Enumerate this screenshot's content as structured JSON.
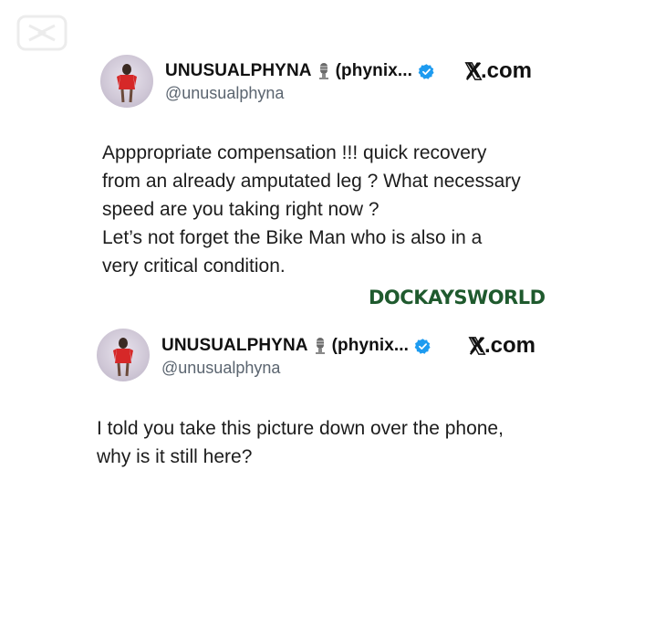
{
  "watermark_text": "DOCKAYSWORLD",
  "tweets": [
    {
      "display_name": "UNUSUALPHYNA",
      "name_suffix": "(phynix...",
      "handle": "@unusualphyna",
      "site": "X.com",
      "lines": [
        "Apppropriate compensation !!! quick recovery",
        "from an already amputated leg ? What necessary",
        "speed are you taking right now ?",
        "Let’s not forget the Bike Man who is also in a",
        "very critical condition."
      ]
    },
    {
      "display_name": "UNUSUALPHYNA",
      "name_suffix": "(phynix...",
      "handle": "@unusualphyna",
      "site": "X.com",
      "lines": [
        "I told you take this picture down over the phone,",
        "why is it still here?"
      ]
    }
  ],
  "colors": {
    "verified": "#1d9bf0",
    "watermark": "#1f5a2e",
    "handle": "#5b6570"
  },
  "icons": [
    "capcut-logo-icon",
    "microphone-icon",
    "verified-badge-icon",
    "x-logo-icon"
  ]
}
